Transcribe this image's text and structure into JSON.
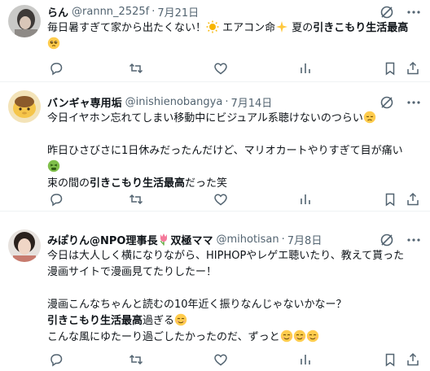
{
  "tweets": [
    {
      "name": "らん",
      "handle": "@rannn_2525f",
      "sep": "·",
      "date": "7月21日",
      "lines": [
        {
          "pre": "毎日暑すぎて家から出たくない！",
          "e1": "sun-emoji",
          "mid": " エアコン命",
          "e2": "sparkles-emoji",
          "mid2": " 夏の",
          "bold": "引きこもり生活最高",
          "post": ""
        },
        {
          "pre": "",
          "e1": "pleading-face-emoji",
          "mid": "",
          "e2": "",
          "mid2": "",
          "bold": "",
          "post": ""
        }
      ]
    },
    {
      "name": "バンギャ専用垢",
      "handle": "@inishienobangya",
      "sep": "·",
      "date": "7月14日",
      "lines": [
        {
          "text": "今日イヤホン忘れてしまい移動中にビジュアル系聴けないのつらい",
          "emoji": "disappointed-face-emoji"
        },
        {
          "text": ""
        },
        {
          "text": "昨日ひさびさに1日休みだったんだけど、マリオカートやりすぎて目が痛い"
        },
        {
          "text": "",
          "emoji": "tired-face-emoji"
        },
        {
          "pre": "束の間の",
          "bold": "引きこもり生活最高",
          "post": "だった笑"
        }
      ]
    },
    {
      "name": "みぽりん@NPO理事長",
      "name_suffix": " 双極ママ",
      "handle": "@mihotisan",
      "sep": "·",
      "date": "7月8日",
      "lines": [
        {
          "text": "今日は大人しく横になりながら、HIPHOPやレゲエ聴いたり、教えて貰った"
        },
        {
          "text": "漫画サイトで漫画見てたりしたー！"
        },
        {
          "text": ""
        },
        {
          "text": "漫画こんなちゃんと読むの10年近く振りなんじゃないかなー？"
        },
        {
          "pre": "",
          "bold": "引きこもり生活最高",
          "post": "過ぎる",
          "emoji": "relieved-face-emoji"
        },
        {
          "text": "こんな風にゆたーり過ごしたかったのだ、ずっと",
          "emoji": "relieved-face-emoji-x3"
        }
      ]
    }
  ],
  "icons": {
    "grok": "grok-icon",
    "more": "more-icon",
    "reply": "reply-icon",
    "retweet": "retweet-icon",
    "like": "like-icon",
    "views": "views-icon",
    "bookmark": "bookmark-icon",
    "share": "share-icon"
  },
  "colors": {
    "text": "#0f1419",
    "secondary": "#536471",
    "divider": "#eff3f4"
  }
}
